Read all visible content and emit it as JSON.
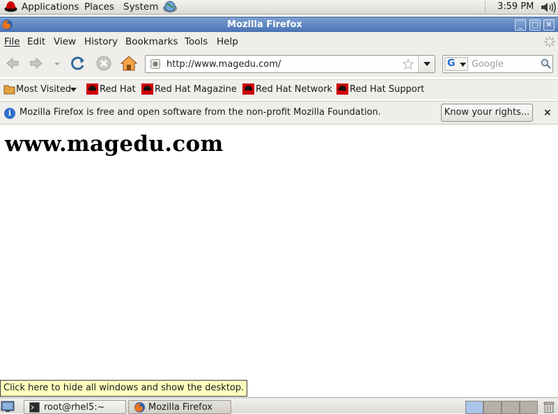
{
  "top_panel": {
    "menus": [
      "Applications",
      "Places",
      "System"
    ],
    "clock": "3:59 PM"
  },
  "window": {
    "title": "Mozilla Firefox"
  },
  "menubar": {
    "items": [
      "File",
      "Edit",
      "View",
      "History",
      "Bookmarks",
      "Tools",
      "Help"
    ]
  },
  "navigation": {
    "url": "http://www.magedu.com/",
    "search_placeholder": "Google"
  },
  "bookmarks": {
    "items": [
      "Most Visited",
      "Red Hat",
      "Red Hat Magazine",
      "Red Hat Network",
      "Red Hat Support"
    ]
  },
  "notification": {
    "text": "Mozilla Firefox is free and open software from the non-profit Mozilla Foundation.",
    "button_label": "Know your rights...",
    "close_glyph": "×"
  },
  "page": {
    "heading": "www.magedu.com"
  },
  "tooltip": {
    "text": "Click here to hide all windows and show the desktop."
  },
  "taskbar": {
    "tasks": [
      "root@rhel5:~",
      "Mozilla Firefox"
    ]
  },
  "colors": {
    "titlebar": "#4a73b5",
    "tooltip_bg": "#ffffbf",
    "redhat_red": "#cc0000"
  }
}
